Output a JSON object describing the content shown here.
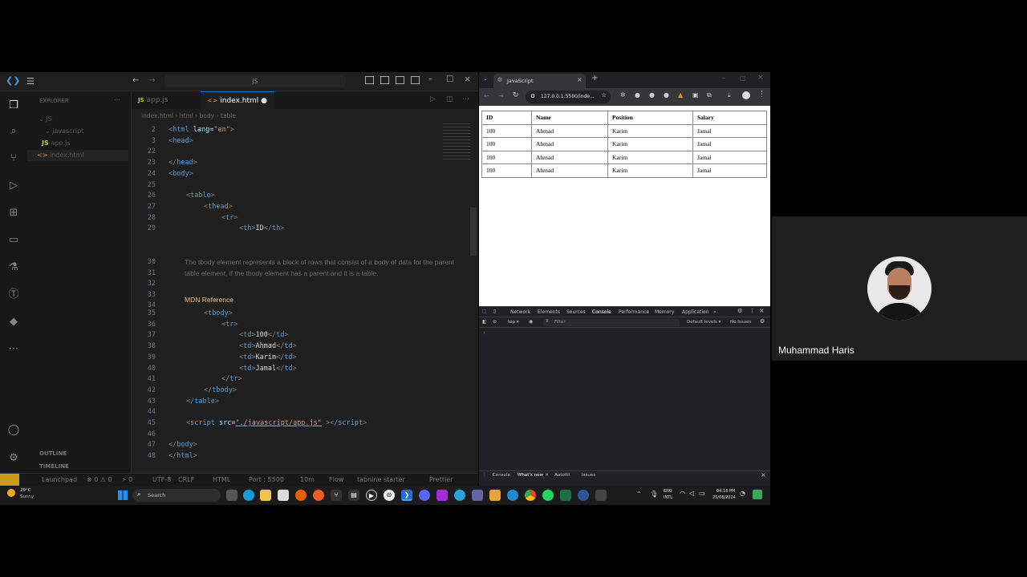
{
  "vscode": {
    "title_search": "JS",
    "explorer_label": "EXPLORER",
    "tree": [
      {
        "label": "JS",
        "type": "folder"
      },
      {
        "label": "javascript",
        "type": "folder"
      },
      {
        "label": "app.js",
        "type": "file-js"
      },
      {
        "label": "index.html",
        "type": "file-html"
      }
    ],
    "outline_label": "OUTLINE",
    "timeline_label": "TIMELINE",
    "tabs": [
      {
        "label": "app.js",
        "active": false
      },
      {
        "label": "index.html",
        "active": true
      }
    ],
    "breadcrumb": [
      "index.html",
      "html",
      "body",
      "table"
    ],
    "lines": [
      {
        "n": "2",
        "indent": 0,
        "parts": [
          [
            "punct",
            "<"
          ],
          [
            "tag",
            "html "
          ],
          [
            "attr",
            "lang"
          ],
          [
            "txt",
            "="
          ],
          [
            "str",
            "\"en\""
          ],
          [
            "punct",
            ">"
          ]
        ]
      },
      {
        "n": "3",
        "indent": 0,
        "parts": [
          [
            "punct",
            "<"
          ],
          [
            "tag",
            "head"
          ],
          [
            "punct",
            ">"
          ]
        ]
      },
      {
        "n": "22",
        "indent": 0,
        "parts": []
      },
      {
        "n": "23",
        "indent": 0,
        "parts": [
          [
            "punct",
            "</"
          ],
          [
            "tag",
            "head"
          ],
          [
            "punct",
            ">"
          ]
        ]
      },
      {
        "n": "24",
        "indent": 0,
        "parts": [
          [
            "punct",
            "<"
          ],
          [
            "tag",
            "body"
          ],
          [
            "punct",
            ">"
          ]
        ]
      },
      {
        "n": "25",
        "indent": 0,
        "parts": []
      },
      {
        "n": "26",
        "indent": 1,
        "parts": [
          [
            "punct",
            "<"
          ],
          [
            "tag",
            "table"
          ],
          [
            "punct",
            ">"
          ]
        ]
      },
      {
        "n": "27",
        "indent": 2,
        "parts": [
          [
            "punct",
            "<"
          ],
          [
            "tag",
            "thead"
          ],
          [
            "punct",
            ">"
          ]
        ]
      },
      {
        "n": "28",
        "indent": 3,
        "parts": [
          [
            "punct",
            "<"
          ],
          [
            "tag",
            "tr"
          ],
          [
            "punct",
            ">"
          ]
        ]
      },
      {
        "n": "29",
        "indent": 4,
        "parts": [
          [
            "punct",
            "<"
          ],
          [
            "tag",
            "th"
          ],
          [
            "punct",
            ">"
          ],
          [
            "txt",
            "ID"
          ],
          [
            "punct",
            "</"
          ],
          [
            "tag",
            "th"
          ],
          [
            "punct",
            ">"
          ]
        ]
      }
    ],
    "hover_doc": "The tbody element represents a block of rows that consist of a body of data for the parent table element, if the tbody element has a parent and it is a table.",
    "hover_gutter": [
      "30",
      "31",
      "32",
      "33",
      "34"
    ],
    "mdn_reference": "MDN Reference",
    "lines2": [
      {
        "n": "35",
        "indent": 2,
        "parts": [
          [
            "punct",
            "<"
          ],
          [
            "tag",
            "tbody"
          ],
          [
            "punct",
            ">"
          ]
        ]
      },
      {
        "n": "36",
        "indent": 3,
        "parts": [
          [
            "punct",
            "<"
          ],
          [
            "tag",
            "tr"
          ],
          [
            "punct",
            ">"
          ]
        ]
      },
      {
        "n": "37",
        "indent": 4,
        "parts": [
          [
            "punct",
            "<"
          ],
          [
            "tag",
            "td"
          ],
          [
            "punct",
            ">"
          ],
          [
            "txt",
            "100"
          ],
          [
            "punct",
            "</"
          ],
          [
            "tag",
            "td"
          ],
          [
            "punct",
            ">"
          ]
        ]
      },
      {
        "n": "38",
        "indent": 4,
        "parts": [
          [
            "punct",
            "<"
          ],
          [
            "tag",
            "td"
          ],
          [
            "punct",
            ">"
          ],
          [
            "txt",
            "Ahmad"
          ],
          [
            "punct",
            "</"
          ],
          [
            "tag",
            "td"
          ],
          [
            "punct",
            ">"
          ]
        ]
      },
      {
        "n": "39",
        "indent": 4,
        "parts": [
          [
            "punct",
            "<"
          ],
          [
            "tag",
            "td"
          ],
          [
            "punct",
            ">"
          ],
          [
            "txt",
            "Karim"
          ],
          [
            "punct",
            "</"
          ],
          [
            "tag",
            "td"
          ],
          [
            "punct",
            ">"
          ]
        ]
      },
      {
        "n": "40",
        "indent": 4,
        "parts": [
          [
            "punct",
            "<"
          ],
          [
            "tag",
            "td"
          ],
          [
            "punct",
            ">"
          ],
          [
            "txt",
            "Jamal"
          ],
          [
            "punct",
            "</"
          ],
          [
            "tag",
            "td"
          ],
          [
            "punct",
            ">"
          ]
        ]
      },
      {
        "n": "41",
        "indent": 3,
        "parts": [
          [
            "punct",
            "</"
          ],
          [
            "tag",
            "tr"
          ],
          [
            "punct",
            ">"
          ]
        ]
      },
      {
        "n": "42",
        "indent": 2,
        "parts": [
          [
            "punct",
            "</"
          ],
          [
            "tag",
            "tbody"
          ],
          [
            "punct",
            ">"
          ]
        ]
      },
      {
        "n": "43",
        "indent": 1,
        "parts": [
          [
            "punct",
            "</"
          ],
          [
            "tag",
            "table"
          ],
          [
            "punct",
            ">"
          ]
        ]
      },
      {
        "n": "44",
        "indent": 0,
        "parts": []
      },
      {
        "n": "45",
        "indent": 1,
        "parts": [
          [
            "punct",
            "<"
          ],
          [
            "tag",
            "script "
          ],
          [
            "attr",
            "src"
          ],
          [
            "txt",
            "="
          ],
          [
            "str",
            "\"./javascript/app.js\""
          ],
          [
            "punct",
            " ></"
          ],
          [
            "tag",
            "script"
          ],
          [
            "punct",
            ">"
          ]
        ]
      },
      {
        "n": "46",
        "indent": 0,
        "parts": []
      },
      {
        "n": "47",
        "indent": 0,
        "parts": [
          [
            "punct",
            "</"
          ],
          [
            "tag",
            "body"
          ],
          [
            "punct",
            ">"
          ]
        ]
      },
      {
        "n": "48",
        "indent": 0,
        "parts": [
          [
            "punct",
            "</"
          ],
          [
            "tag",
            "html"
          ],
          [
            "punct",
            ">"
          ]
        ]
      }
    ],
    "status": {
      "live_share": "Launchpad",
      "errors": "⊗ 0 ⚠ 0",
      "ports": "⚡ 0",
      "encoding": "UTF-8",
      "eol": "CRLF",
      "language": "HTML",
      "port": "Port : 5500",
      "extra": "10m",
      "flow": "Flow",
      "tabnine": "tabnine starter",
      "prettier": "Prettier"
    }
  },
  "browser": {
    "tab_title": "JavaScript",
    "url": "127.0.0.1:5500/inde...",
    "table": {
      "headers": [
        "ID",
        "Name",
        "Position",
        "Salary"
      ],
      "rows": [
        [
          "100",
          "Ahmad",
          "Karim",
          "Jamal"
        ],
        [
          "100",
          "Ahmad",
          "Karim",
          "Jamal"
        ],
        [
          "100",
          "Ahmad",
          "Karim",
          "Jamal"
        ],
        [
          "100",
          "Ahmad",
          "Karim",
          "Jamal"
        ]
      ]
    },
    "devtools": {
      "tabs": [
        "Network",
        "Elements",
        "Sources",
        "Console",
        "Performance",
        "Memory",
        "Application",
        "»"
      ],
      "context": "top ▾",
      "filter_placeholder": "Filter",
      "levels": "Default levels ▾",
      "issues": "No Issues",
      "drawer_tabs": [
        "Console",
        "What's new",
        "Autofill",
        "Issues"
      ]
    }
  },
  "taskbar": {
    "weather_temp": "29°C",
    "weather_desc": "Sunny",
    "search": "Search",
    "lang": "ENG",
    "lang2": "INTL",
    "time": "04:18 PM",
    "date": "25/08/2024"
  },
  "webcam": {
    "name": "Muhammad Haris"
  }
}
